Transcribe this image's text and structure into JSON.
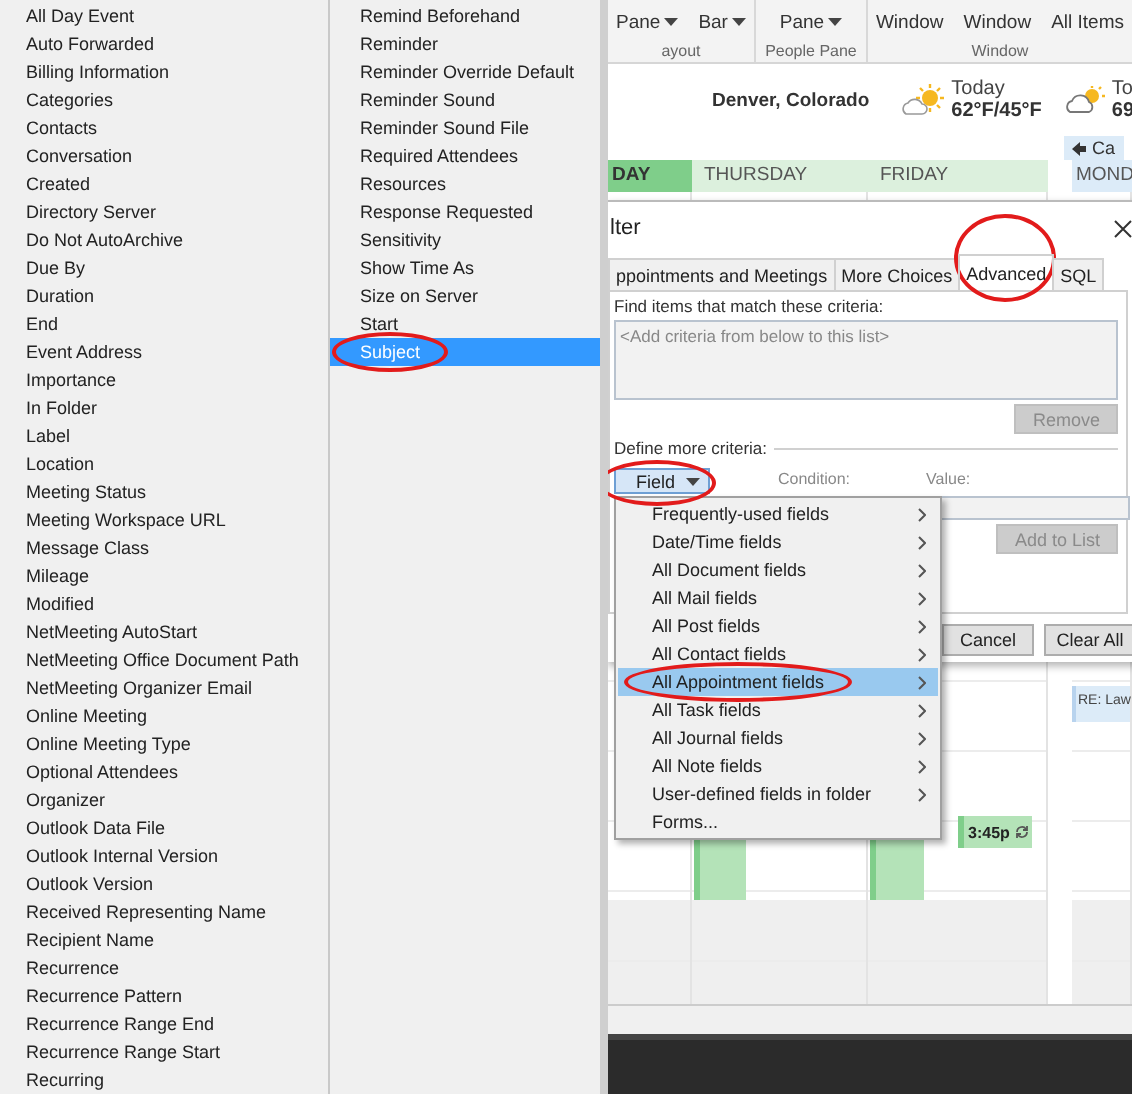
{
  "field_list": {
    "columns": [
      {
        "items": [
          {
            "label": "All Day Event",
            "selected": false,
            "circled": false
          },
          {
            "label": "Auto Forwarded",
            "selected": false,
            "circled": false
          },
          {
            "label": "Billing Information",
            "selected": false,
            "circled": false
          },
          {
            "label": "Categories",
            "selected": false,
            "circled": false
          },
          {
            "label": "Contacts",
            "selected": false,
            "circled": false
          },
          {
            "label": "Conversation",
            "selected": false,
            "circled": false
          },
          {
            "label": "Created",
            "selected": false,
            "circled": false
          },
          {
            "label": "Directory Server",
            "selected": false,
            "circled": false
          },
          {
            "label": "Do Not AutoArchive",
            "selected": false,
            "circled": false
          },
          {
            "label": "Due By",
            "selected": false,
            "circled": false
          },
          {
            "label": "Duration",
            "selected": false,
            "circled": false
          },
          {
            "label": "End",
            "selected": false,
            "circled": false
          },
          {
            "label": "Event Address",
            "selected": false,
            "circled": false
          },
          {
            "label": "Importance",
            "selected": false,
            "circled": false
          },
          {
            "label": "In Folder",
            "selected": false,
            "circled": false
          },
          {
            "label": "Label",
            "selected": false,
            "circled": false
          },
          {
            "label": "Location",
            "selected": false,
            "circled": false
          },
          {
            "label": "Meeting Status",
            "selected": false,
            "circled": false
          },
          {
            "label": "Meeting Workspace URL",
            "selected": false,
            "circled": false
          },
          {
            "label": "Message Class",
            "selected": false,
            "circled": false
          },
          {
            "label": "Mileage",
            "selected": false,
            "circled": false
          },
          {
            "label": "Modified",
            "selected": false,
            "circled": false
          },
          {
            "label": "NetMeeting AutoStart",
            "selected": false,
            "circled": false
          },
          {
            "label": "NetMeeting Office Document Path",
            "selected": false,
            "circled": false
          },
          {
            "label": "NetMeeting Organizer Email",
            "selected": false,
            "circled": false
          },
          {
            "label": "Online Meeting",
            "selected": false,
            "circled": false
          },
          {
            "label": "Online Meeting Type",
            "selected": false,
            "circled": false
          },
          {
            "label": "Optional Attendees",
            "selected": false,
            "circled": false
          },
          {
            "label": "Organizer",
            "selected": false,
            "circled": false
          },
          {
            "label": "Outlook Data File",
            "selected": false,
            "circled": false
          },
          {
            "label": "Outlook Internal Version",
            "selected": false,
            "circled": false
          },
          {
            "label": "Outlook Version",
            "selected": false,
            "circled": false
          },
          {
            "label": "Received Representing Name",
            "selected": false,
            "circled": false
          },
          {
            "label": "Recipient Name",
            "selected": false,
            "circled": false
          },
          {
            "label": "Recurrence",
            "selected": false,
            "circled": false
          },
          {
            "label": "Recurrence Pattern",
            "selected": false,
            "circled": false
          },
          {
            "label": "Recurrence Range End",
            "selected": false,
            "circled": false
          },
          {
            "label": "Recurrence Range Start",
            "selected": false,
            "circled": false
          },
          {
            "label": "Recurring",
            "selected": false,
            "circled": false
          }
        ]
      },
      {
        "items": [
          {
            "label": "Remind Beforehand",
            "selected": false,
            "circled": false
          },
          {
            "label": "Reminder",
            "selected": false,
            "circled": false
          },
          {
            "label": "Reminder Override Default",
            "selected": false,
            "circled": false
          },
          {
            "label": "Reminder Sound",
            "selected": false,
            "circled": false
          },
          {
            "label": "Reminder Sound File",
            "selected": false,
            "circled": false
          },
          {
            "label": "Required Attendees",
            "selected": false,
            "circled": false
          },
          {
            "label": "Resources",
            "selected": false,
            "circled": false
          },
          {
            "label": "Response Requested",
            "selected": false,
            "circled": false
          },
          {
            "label": "Sensitivity",
            "selected": false,
            "circled": false
          },
          {
            "label": "Show Time As",
            "selected": false,
            "circled": false
          },
          {
            "label": "Size on Server",
            "selected": false,
            "circled": false
          },
          {
            "label": "Start",
            "selected": false,
            "circled": false
          },
          {
            "label": "Subject",
            "selected": true,
            "circled": true
          }
        ]
      }
    ]
  },
  "ribbon": {
    "groups": [
      {
        "label": "ayout",
        "buttons": [
          {
            "label": "Pane",
            "has_menu": true
          },
          {
            "label": "Bar",
            "has_menu": true
          }
        ]
      },
      {
        "label": "People Pane",
        "buttons": [
          {
            "label": "Pane",
            "has_menu": true
          }
        ]
      },
      {
        "label": "Window",
        "buttons": [
          {
            "label": "Window",
            "has_menu": false
          },
          {
            "label": "Window",
            "has_menu": false
          },
          {
            "label": "All Items",
            "has_menu": false
          }
        ]
      }
    ]
  },
  "weather": {
    "location": "Denver, Colorado",
    "days": [
      {
        "label": "Today",
        "temps": "62°F/45°F",
        "kind": "sun-cloud"
      },
      {
        "label": "To",
        "temps": "69",
        "kind": "cloud-sun"
      }
    ]
  },
  "calendar": {
    "back_label": "Ca",
    "days": [
      {
        "label": "DAY",
        "kind": "today"
      },
      {
        "label": "THURSDAY",
        "kind": "week",
        "events": [
          {
            "kind": "busy"
          }
        ]
      },
      {
        "label": "FRIDAY",
        "kind": "week",
        "events": [
          {
            "kind": "busy"
          },
          {
            "kind": "recurring",
            "label": "3:45p"
          }
        ]
      },
      {
        "label": "MOND",
        "kind": "next",
        "events": [
          {
            "kind": "meeting",
            "label": "RE: Law"
          }
        ]
      }
    ]
  },
  "dialog": {
    "title": "lter",
    "tabs": [
      {
        "label": "ppointments and Meetings",
        "selected": false,
        "circled": false
      },
      {
        "label": "More Choices",
        "selected": false,
        "circled": false
      },
      {
        "label": "Advanced",
        "selected": true,
        "circled": true
      },
      {
        "label": "SQL",
        "selected": false,
        "circled": false
      }
    ],
    "criteria_label": "Find items that match these criteria:",
    "criteria_placeholder": "<Add criteria from below to this list>",
    "remove_button": {
      "label": "Remove",
      "disabled": true
    },
    "define_label": "Define more criteria:",
    "field_button": {
      "label": "Field",
      "circled": true
    },
    "condition_label": "Condition:",
    "value_label": "Value:",
    "add_button": {
      "label": "Add to List",
      "disabled": true
    },
    "buttons": [
      {
        "label": "Cancel"
      },
      {
        "label": "Clear All"
      }
    ]
  },
  "field_menu": {
    "items": [
      {
        "label": "Frequently-used fields",
        "submenu": true,
        "selected": false,
        "circled": false
      },
      {
        "label": "Date/Time fields",
        "submenu": true,
        "selected": false,
        "circled": false
      },
      {
        "label": "All Document fields",
        "submenu": true,
        "selected": false,
        "circled": false
      },
      {
        "label": "All Mail fields",
        "submenu": true,
        "selected": false,
        "circled": false
      },
      {
        "label": "All Post fields",
        "submenu": true,
        "selected": false,
        "circled": false
      },
      {
        "label": "All Contact fields",
        "submenu": true,
        "selected": false,
        "circled": false
      },
      {
        "label": "All Appointment fields",
        "submenu": true,
        "selected": true,
        "circled": true
      },
      {
        "label": "All Task fields",
        "submenu": true,
        "selected": false,
        "circled": false
      },
      {
        "label": "All Journal fields",
        "submenu": true,
        "selected": false,
        "circled": false
      },
      {
        "label": "All Note fields",
        "submenu": true,
        "selected": false,
        "circled": false
      },
      {
        "label": "User-defined fields in folder",
        "submenu": true,
        "selected": false,
        "circled": false
      },
      {
        "label": "Forms...",
        "submenu": false,
        "selected": false,
        "circled": false
      }
    ]
  }
}
